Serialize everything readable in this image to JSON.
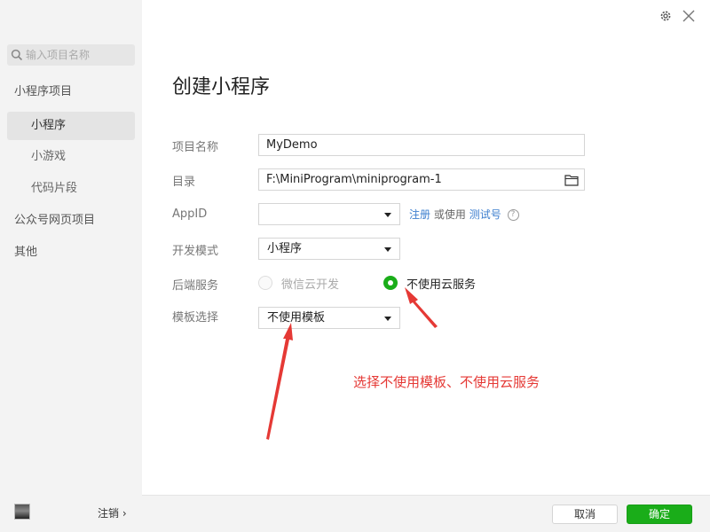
{
  "sidebar": {
    "search_placeholder": "输入项目名称",
    "items": [
      {
        "label": "小程序项目"
      },
      {
        "label": "小程序"
      },
      {
        "label": "小游戏"
      },
      {
        "label": "代码片段"
      },
      {
        "label": "公众号网页项目"
      },
      {
        "label": "其他"
      }
    ],
    "logout_label": "注销 ›"
  },
  "page_title": "创建小程序",
  "form": {
    "name_label": "项目名称",
    "name_value": "MyDemo",
    "dir_label": "目录",
    "dir_value": "F:\\MiniProgram\\miniprogram-1",
    "appid_label": "AppID",
    "appid_value": "",
    "appid_register": "注册",
    "appid_or": "或使用",
    "appid_test": "测试号",
    "mode_label": "开发模式",
    "mode_value": "小程序",
    "backend_label": "后端服务",
    "backend_cloud": "微信云开发",
    "backend_none": "不使用云服务",
    "template_label": "模板选择",
    "template_value": "不使用模板"
  },
  "annotation": "选择不使用模板、不使用云服务",
  "footer": {
    "cancel_label": "取消",
    "ok_label": "确定"
  },
  "colors": {
    "accent": "#1aad19",
    "link": "#3e7fcf",
    "annotation": "#e53935"
  }
}
